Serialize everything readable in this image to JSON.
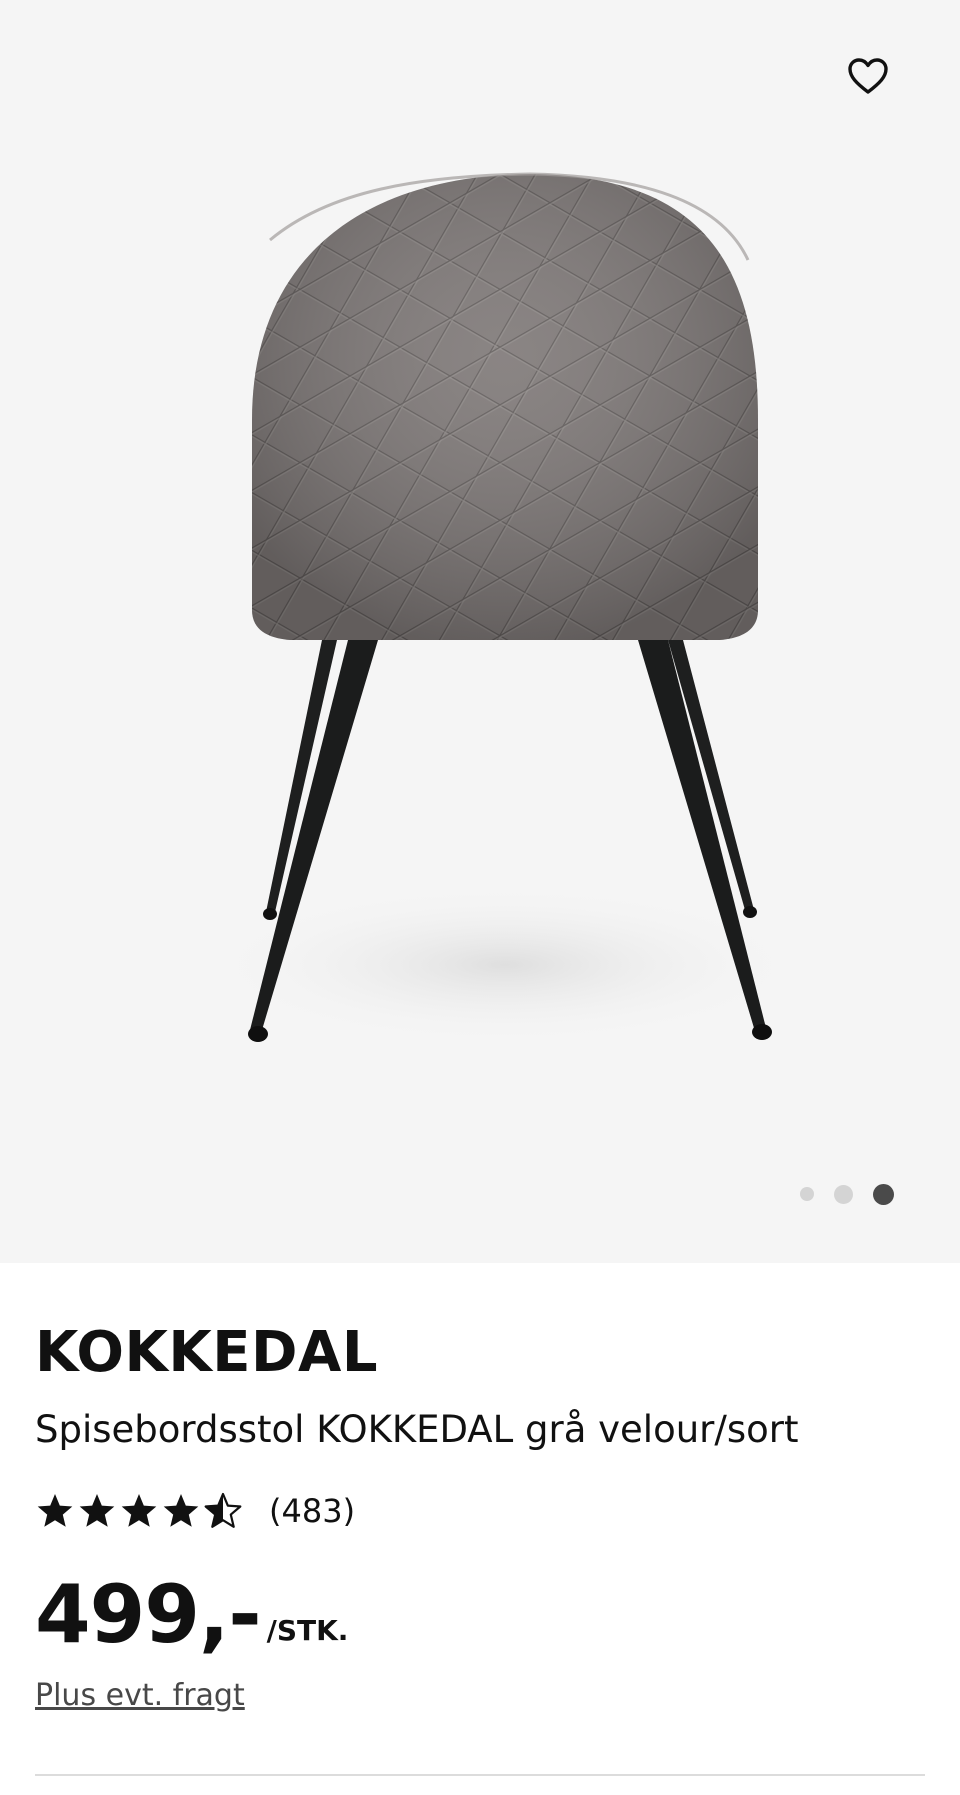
{
  "product": {
    "name": "KOKKEDAL",
    "description": "Spisebordsstol KOKKEDAL grå velour/sort",
    "rating": 4.5,
    "rating_max": 5,
    "review_count": "(483)",
    "price": "499,-",
    "unit": "/STK.",
    "freight_link": "Plus evt. fragt"
  },
  "gallery": {
    "image_count": 3,
    "active_index": 3,
    "favorite_icon": "heart-outline-icon",
    "colors": {
      "background": "#f5f5f5",
      "upholstery": "#7c7675",
      "legs": "#1b1c1c",
      "dot_inactive": "#d4d4d4",
      "dot_active": "#4a4a4a"
    }
  }
}
